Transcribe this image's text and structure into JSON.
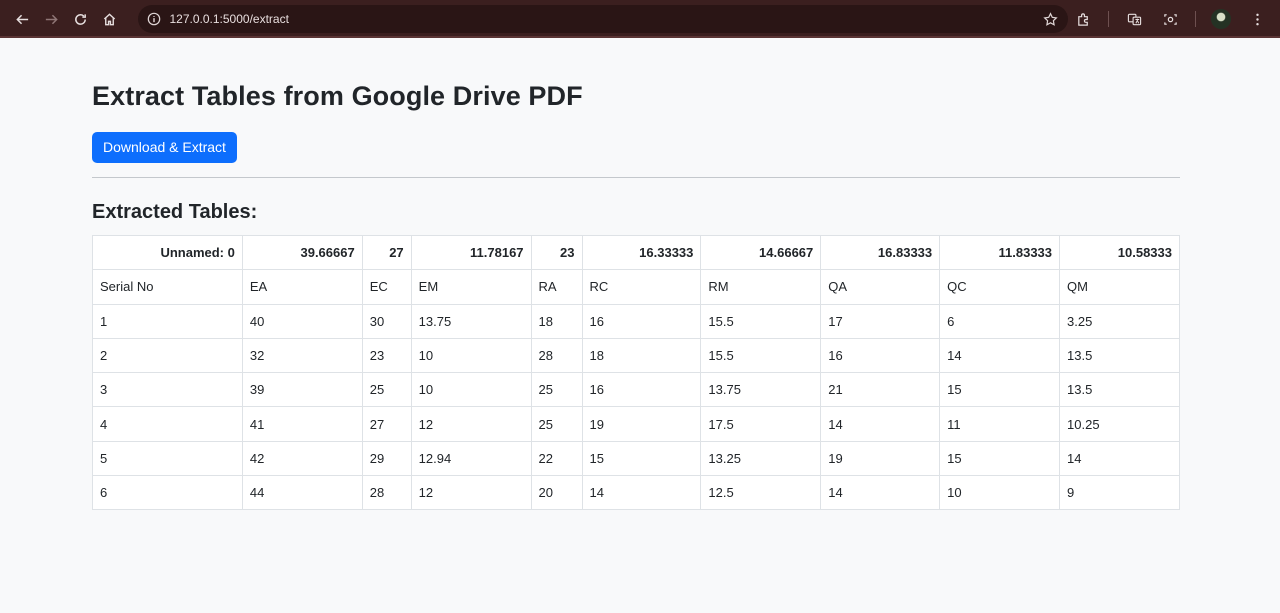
{
  "browser": {
    "url": "127.0.0.1:5000/extract"
  },
  "page": {
    "title": "Extract Tables from Google Drive PDF",
    "button_label": "Download & Extract",
    "section_title": "Extracted Tables:"
  },
  "table": {
    "headers": [
      "Unnamed: 0",
      "39.66667",
      "27",
      "11.78167",
      "23",
      "16.33333",
      "14.66667",
      "16.83333",
      "11.83333",
      "10.58333"
    ],
    "rows": [
      [
        "Serial No",
        "EA",
        "EC",
        "EM",
        "RA",
        "RC",
        "RM",
        "QA",
        "QC",
        "QM"
      ],
      [
        "1",
        "40",
        "30",
        "13.75",
        "18",
        "16",
        "15.5",
        "17",
        "6",
        "3.25"
      ],
      [
        "2",
        "32",
        "23",
        "10",
        "28",
        "18",
        "15.5",
        "16",
        "14",
        "13.5"
      ],
      [
        "3",
        "39",
        "25",
        "10",
        "25",
        "16",
        "13.75",
        "21",
        "15",
        "13.5"
      ],
      [
        "4",
        "41",
        "27",
        "12",
        "25",
        "19",
        "17.5",
        "14",
        "11",
        "10.25"
      ],
      [
        "5",
        "42",
        "29",
        "12.94",
        "22",
        "15",
        "13.25",
        "19",
        "15",
        "14"
      ],
      [
        "6",
        "44",
        "28",
        "12",
        "20",
        "14",
        "12.5",
        "14",
        "10",
        "9"
      ]
    ]
  }
}
